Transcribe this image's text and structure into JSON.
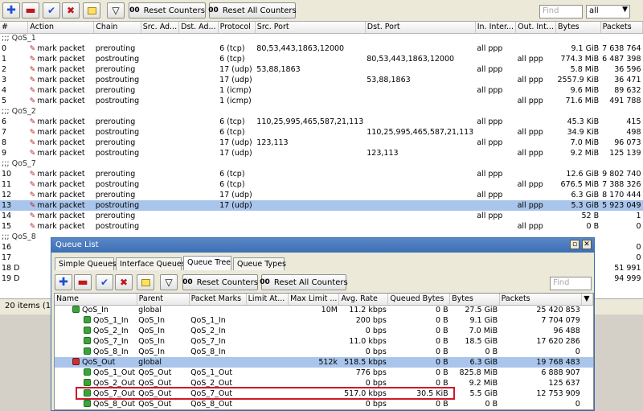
{
  "toolbar": {
    "reset_counters": "Reset Counters",
    "reset_all_counters": "Reset All Counters",
    "oo": "00",
    "find_placeholder": "Find",
    "filter_value": "all"
  },
  "mangle": {
    "columns": [
      "#",
      "Action",
      "Chain",
      "Src. Ad...",
      "Dst. Ad...",
      "Protocol",
      "Src. Port",
      "Dst. Port",
      "In. Inter...",
      "Out. Int...",
      "Bytes",
      "Packets"
    ],
    "rows": [
      {
        "type": "group",
        "label": ";;; QoS_1"
      },
      {
        "id": "0",
        "action": "mark packet",
        "chain": "prerouting",
        "proto": "6 (tcp)",
        "sport": "80,53,443,1863,12000",
        "dport": "",
        "in": "all ppp",
        "out": "",
        "bytes": "9.1 GiB",
        "packets": "7 638 764"
      },
      {
        "id": "1",
        "action": "mark packet",
        "chain": "postrouting",
        "proto": "6 (tcp)",
        "sport": "",
        "dport": "80,53,443,1863,12000",
        "in": "",
        "out": "all ppp",
        "bytes": "774.3 MiB",
        "packets": "6 487 398"
      },
      {
        "id": "2",
        "action": "mark packet",
        "chain": "prerouting",
        "proto": "17 (udp)",
        "sport": "53,88,1863",
        "dport": "",
        "in": "all ppp",
        "out": "",
        "bytes": "5.8 MiB",
        "packets": "36 596"
      },
      {
        "id": "3",
        "action": "mark packet",
        "chain": "postrouting",
        "proto": "17 (udp)",
        "sport": "",
        "dport": "53,88,1863",
        "in": "",
        "out": "all ppp",
        "bytes": "2557.9 KiB",
        "packets": "36 471"
      },
      {
        "id": "4",
        "action": "mark packet",
        "chain": "prerouting",
        "proto": "1 (icmp)",
        "sport": "",
        "dport": "",
        "in": "all ppp",
        "out": "",
        "bytes": "9.6 MiB",
        "packets": "89 632"
      },
      {
        "id": "5",
        "action": "mark packet",
        "chain": "postrouting",
        "proto": "1 (icmp)",
        "sport": "",
        "dport": "",
        "in": "",
        "out": "all ppp",
        "bytes": "71.6 MiB",
        "packets": "491 788"
      },
      {
        "type": "group",
        "label": ";;; QoS_2"
      },
      {
        "id": "6",
        "action": "mark packet",
        "chain": "prerouting",
        "proto": "6 (tcp)",
        "sport": "110,25,995,465,587,21,113",
        "dport": "",
        "in": "all ppp",
        "out": "",
        "bytes": "45.3 KiB",
        "packets": "415"
      },
      {
        "id": "7",
        "action": "mark packet",
        "chain": "postrouting",
        "proto": "6 (tcp)",
        "sport": "",
        "dport": "110,25,995,465,587,21,113",
        "in": "",
        "out": "all ppp",
        "bytes": "34.9 KiB",
        "packets": "498"
      },
      {
        "id": "8",
        "action": "mark packet",
        "chain": "prerouting",
        "proto": "17 (udp)",
        "sport": "123,113",
        "dport": "",
        "in": "all ppp",
        "out": "",
        "bytes": "7.0 MiB",
        "packets": "96 073"
      },
      {
        "id": "9",
        "action": "mark packet",
        "chain": "postrouting",
        "proto": "17 (udp)",
        "sport": "",
        "dport": "123,113",
        "in": "",
        "out": "all ppp",
        "bytes": "9.2 MiB",
        "packets": "125 139"
      },
      {
        "type": "group",
        "label": ";;; QoS_7"
      },
      {
        "id": "10",
        "action": "mark packet",
        "chain": "prerouting",
        "proto": "6 (tcp)",
        "sport": "",
        "dport": "",
        "in": "all ppp",
        "out": "",
        "bytes": "12.6 GiB",
        "packets": "9 802 740"
      },
      {
        "id": "11",
        "action": "mark packet",
        "chain": "postrouting",
        "proto": "6 (tcp)",
        "sport": "",
        "dport": "",
        "in": "",
        "out": "all ppp",
        "bytes": "676.5 MiB",
        "packets": "7 388 326"
      },
      {
        "id": "12",
        "action": "mark packet",
        "chain": "prerouting",
        "proto": "17 (udp)",
        "sport": "",
        "dport": "",
        "in": "all ppp",
        "out": "",
        "bytes": "6.3 GiB",
        "packets": "8 170 444"
      },
      {
        "id": "13",
        "action": "mark packet",
        "chain": "postrouting",
        "proto": "17 (udp)",
        "sport": "",
        "dport": "",
        "in": "",
        "out": "all ppp",
        "bytes": "5.3 GiB",
        "packets": "5 923 049",
        "selected": true
      },
      {
        "id": "14",
        "action": "mark packet",
        "chain": "prerouting",
        "proto": "",
        "sport": "",
        "dport": "",
        "in": "all ppp",
        "out": "",
        "bytes": "52 B",
        "packets": "1"
      },
      {
        "id": "15",
        "action": "mark packet",
        "chain": "postrouting",
        "proto": "",
        "sport": "",
        "dport": "",
        "in": "",
        "out": "all ppp",
        "bytes": "0 B",
        "packets": "0"
      },
      {
        "type": "group",
        "label": ";;; QoS_8"
      },
      {
        "id": "16",
        "action": "",
        "chain": "",
        "proto": "",
        "sport": "",
        "dport": "",
        "in": "",
        "out": "",
        "bytes": "",
        "packets": "0"
      },
      {
        "id": "17",
        "action": "",
        "chain": "",
        "proto": "",
        "sport": "",
        "dport": "",
        "in": "",
        "out": "",
        "bytes": "",
        "packets": "0"
      },
      {
        "id": "18 D",
        "action": "",
        "chain": "",
        "proto": "",
        "sport": "",
        "dport": "",
        "in": "",
        "out": "",
        "bytes": "",
        "packets": "51 991"
      },
      {
        "id": "19 D",
        "action": "",
        "chain": "",
        "proto": "",
        "sport": "",
        "dport": "",
        "in": "",
        "out": "",
        "bytes": "",
        "packets": "94 999"
      }
    ],
    "status": "20 items (1 se"
  },
  "queue": {
    "title": "Queue List",
    "tabs": [
      "Simple Queues",
      "Interface Queues",
      "Queue Tree",
      "Queue Types"
    ],
    "active_tab": 2,
    "columns": [
      "Name",
      "Parent",
      "Packet Marks",
      "Limit At...",
      "Max Limit ...",
      "Avg. Rate",
      "Queued Bytes",
      "Bytes",
      "Packets"
    ],
    "rows": [
      {
        "name": "QoS_In",
        "indent": 0,
        "red": false,
        "parent": "global",
        "marks": "",
        "limit": "",
        "max": "10M",
        "rate": "11.2 kbps",
        "queued": "0 B",
        "bytes": "27.5 GiB",
        "packets": "25 420 853"
      },
      {
        "name": "QoS_1_In",
        "indent": 1,
        "red": false,
        "parent": "QoS_In",
        "marks": "QoS_1_In",
        "limit": "",
        "max": "",
        "rate": "200 bps",
        "queued": "0 B",
        "bytes": "9.1 GiB",
        "packets": "7 704 079"
      },
      {
        "name": "QoS_2_In",
        "indent": 1,
        "red": false,
        "parent": "QoS_In",
        "marks": "QoS_2_In",
        "limit": "",
        "max": "",
        "rate": "0 bps",
        "queued": "0 B",
        "bytes": "7.0 MiB",
        "packets": "96 488"
      },
      {
        "name": "QoS_7_In",
        "indent": 1,
        "red": false,
        "parent": "QoS_In",
        "marks": "QoS_7_In",
        "limit": "",
        "max": "",
        "rate": "11.0 kbps",
        "queued": "0 B",
        "bytes": "18.5 GiB",
        "packets": "17 620 286"
      },
      {
        "name": "QoS_8_In",
        "indent": 1,
        "red": false,
        "parent": "QoS_In",
        "marks": "QoS_8_In",
        "limit": "",
        "max": "",
        "rate": "0 bps",
        "queued": "0 B",
        "bytes": "0 B",
        "packets": "0"
      },
      {
        "name": "QoS_Out",
        "indent": 0,
        "red": true,
        "parent": "global",
        "marks": "",
        "limit": "",
        "max": "512k",
        "rate": "518.5 kbps",
        "queued": "0 B",
        "bytes": "6.3 GiB",
        "packets": "19 768 483",
        "selected": true
      },
      {
        "name": "QoS_1_Out",
        "indent": 1,
        "red": false,
        "parent": "QoS_Out",
        "marks": "QoS_1_Out",
        "limit": "",
        "max": "",
        "rate": "776 bps",
        "queued": "0 B",
        "bytes": "825.8 MiB",
        "packets": "6 888 907"
      },
      {
        "name": "QoS_2_Out",
        "indent": 1,
        "red": false,
        "parent": "QoS_Out",
        "marks": "QoS_2_Out",
        "limit": "",
        "max": "",
        "rate": "0 bps",
        "queued": "0 B",
        "bytes": "9.2 MiB",
        "packets": "125 637"
      },
      {
        "name": "QoS_7_Out",
        "indent": 1,
        "red": false,
        "parent": "QoS_Out",
        "marks": "QoS_7_Out",
        "limit": "",
        "max": "",
        "rate": "517.0 kbps",
        "queued": "30.5 KiB",
        "bytes": "5.5 GiB",
        "packets": "12 753 909"
      },
      {
        "name": "QoS_8_Out",
        "indent": 1,
        "red": false,
        "parent": "QoS_Out",
        "marks": "QoS_8_Out",
        "limit": "",
        "max": "",
        "rate": "0 bps",
        "queued": "0 B",
        "bytes": "0 B",
        "packets": "0"
      }
    ]
  },
  "colors": {
    "accent": "#3d6fb5",
    "selected_row": "#a9c5ec",
    "highlight": "#d0182a"
  }
}
